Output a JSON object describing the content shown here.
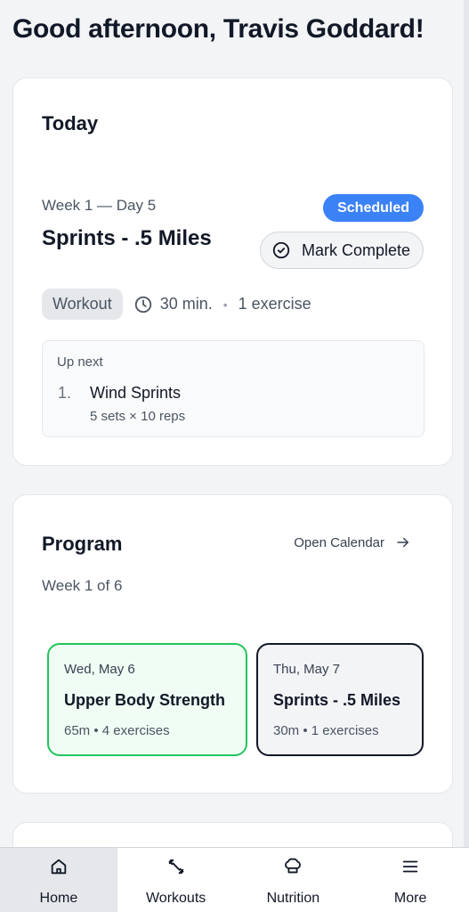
{
  "greeting": "Good afternoon, Travis Goddard!",
  "today": {
    "title": "Today",
    "week_day": "Week 1 — Day 5",
    "workout_title": "Sprints - .5 Miles",
    "status_badge": "Scheduled",
    "mark_complete_label": "Mark Complete",
    "tag": "Workout",
    "duration": "30 min.",
    "exercise_count": "1 exercise",
    "up_next": {
      "label": "Up next",
      "items": [
        {
          "number": "1.",
          "name": "Wind Sprints",
          "detail": "5 sets × 10 reps"
        }
      ]
    }
  },
  "program": {
    "title": "Program",
    "open_calendar_label": "Open Calendar",
    "week_of": "Week 1 of 6",
    "days": [
      {
        "date": "Wed, May 6",
        "name": "Upper Body Strength",
        "meta": "65m • 4 exercises"
      },
      {
        "date": "Thu, May 7",
        "name": "Sprints - .5 Miles",
        "meta": "30m • 1 exercises"
      }
    ]
  },
  "nav": {
    "items": [
      {
        "label": "Home",
        "icon": "home-icon"
      },
      {
        "label": "Workouts",
        "icon": "dumbbell-icon"
      },
      {
        "label": "Nutrition",
        "icon": "chef-hat-icon"
      },
      {
        "label": "More",
        "icon": "menu-icon"
      }
    ],
    "active": "Home"
  },
  "colors": {
    "accent_blue": "#3b82f6",
    "completed_green": "#22c55e",
    "current_border": "#111827"
  }
}
